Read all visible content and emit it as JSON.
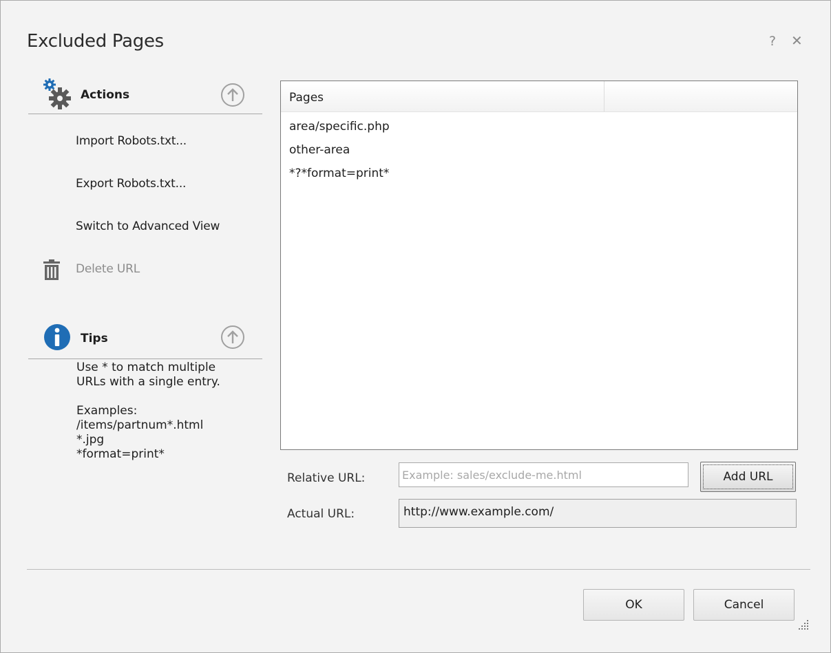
{
  "dialog": {
    "title": "Excluded Pages",
    "help_glyph": "?",
    "close_glyph": "✕"
  },
  "actions": {
    "title": "Actions",
    "icon": "gears-icon",
    "items": [
      {
        "label": "Import Robots.txt..."
      },
      {
        "label": "Export Robots.txt..."
      },
      {
        "label": "Switch to Advanced View"
      },
      {
        "label": "Delete URL",
        "disabled": true,
        "icon": "trash-icon"
      }
    ]
  },
  "tips": {
    "title": "Tips",
    "icon": "info-icon",
    "lines": [
      "Use * to match multiple",
      "URLs with a single entry.",
      "",
      "Examples:",
      "/items/partnum*.html",
      "*.jpg",
      "*format=print*"
    ]
  },
  "pages_list": {
    "column_header": "Pages",
    "rows": [
      "area/specific.php",
      "other-area",
      "*?*format=print*"
    ]
  },
  "form": {
    "relative_label": "Relative URL:",
    "relative_placeholder": "Example: sales/exclude-me.html",
    "relative_value": "",
    "add_url_label": "Add URL",
    "actual_label": "Actual URL:",
    "actual_value": "http://www.example.com/"
  },
  "buttons": {
    "ok": "OK",
    "cancel": "Cancel"
  },
  "colors": {
    "accent_blue": "#1f6db5",
    "gear_gray": "#5a5a5a"
  }
}
